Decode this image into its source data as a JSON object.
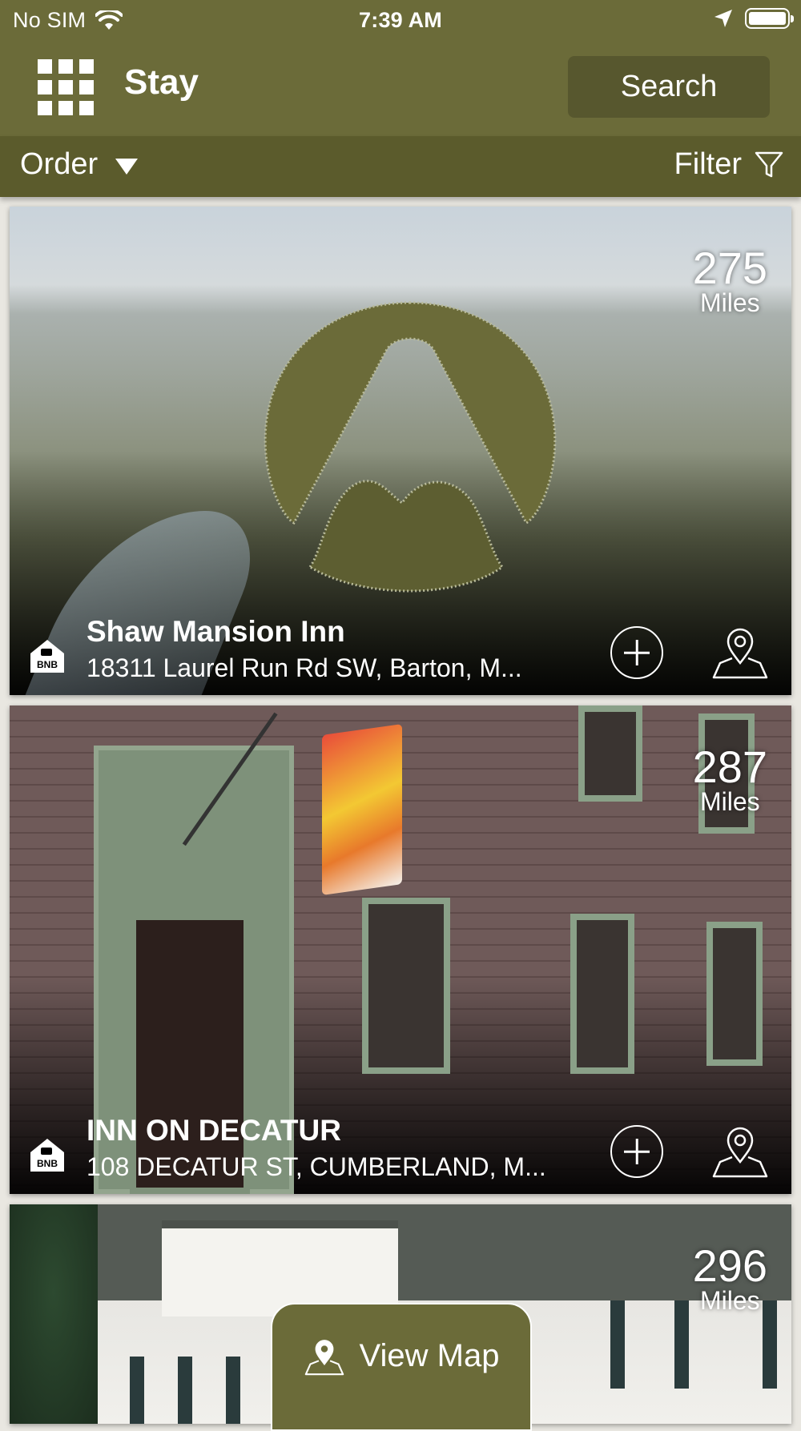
{
  "status_bar": {
    "carrier": "No SIM",
    "time": "7:39 AM"
  },
  "header": {
    "title": "Stay",
    "search_label": "Search",
    "menu_icon": "grid-menu-icon"
  },
  "sort_bar": {
    "order_label": "Order",
    "filter_label": "Filter"
  },
  "listings": [
    {
      "name": "Shaw Mansion Inn",
      "address": "18311 Laurel Run Rd SW, Barton, M...",
      "distance": "275",
      "distance_unit": "Miles",
      "type_icon": "bnb-icon"
    },
    {
      "name": "INN ON DECATUR",
      "address": "108 DECATUR ST, CUMBERLAND, M...",
      "distance": "287",
      "distance_unit": "Miles",
      "type_icon": "bnb-icon"
    },
    {
      "name": "",
      "address": "",
      "distance": "296",
      "distance_unit": "Miles",
      "type_icon": "bnb-icon"
    }
  ],
  "view_map_label": "View Map",
  "colors": {
    "header": "#6b6b39",
    "sort_bar": "#5b5b2c",
    "search_button": "#57572e",
    "logo_green": "#6b6b39"
  }
}
